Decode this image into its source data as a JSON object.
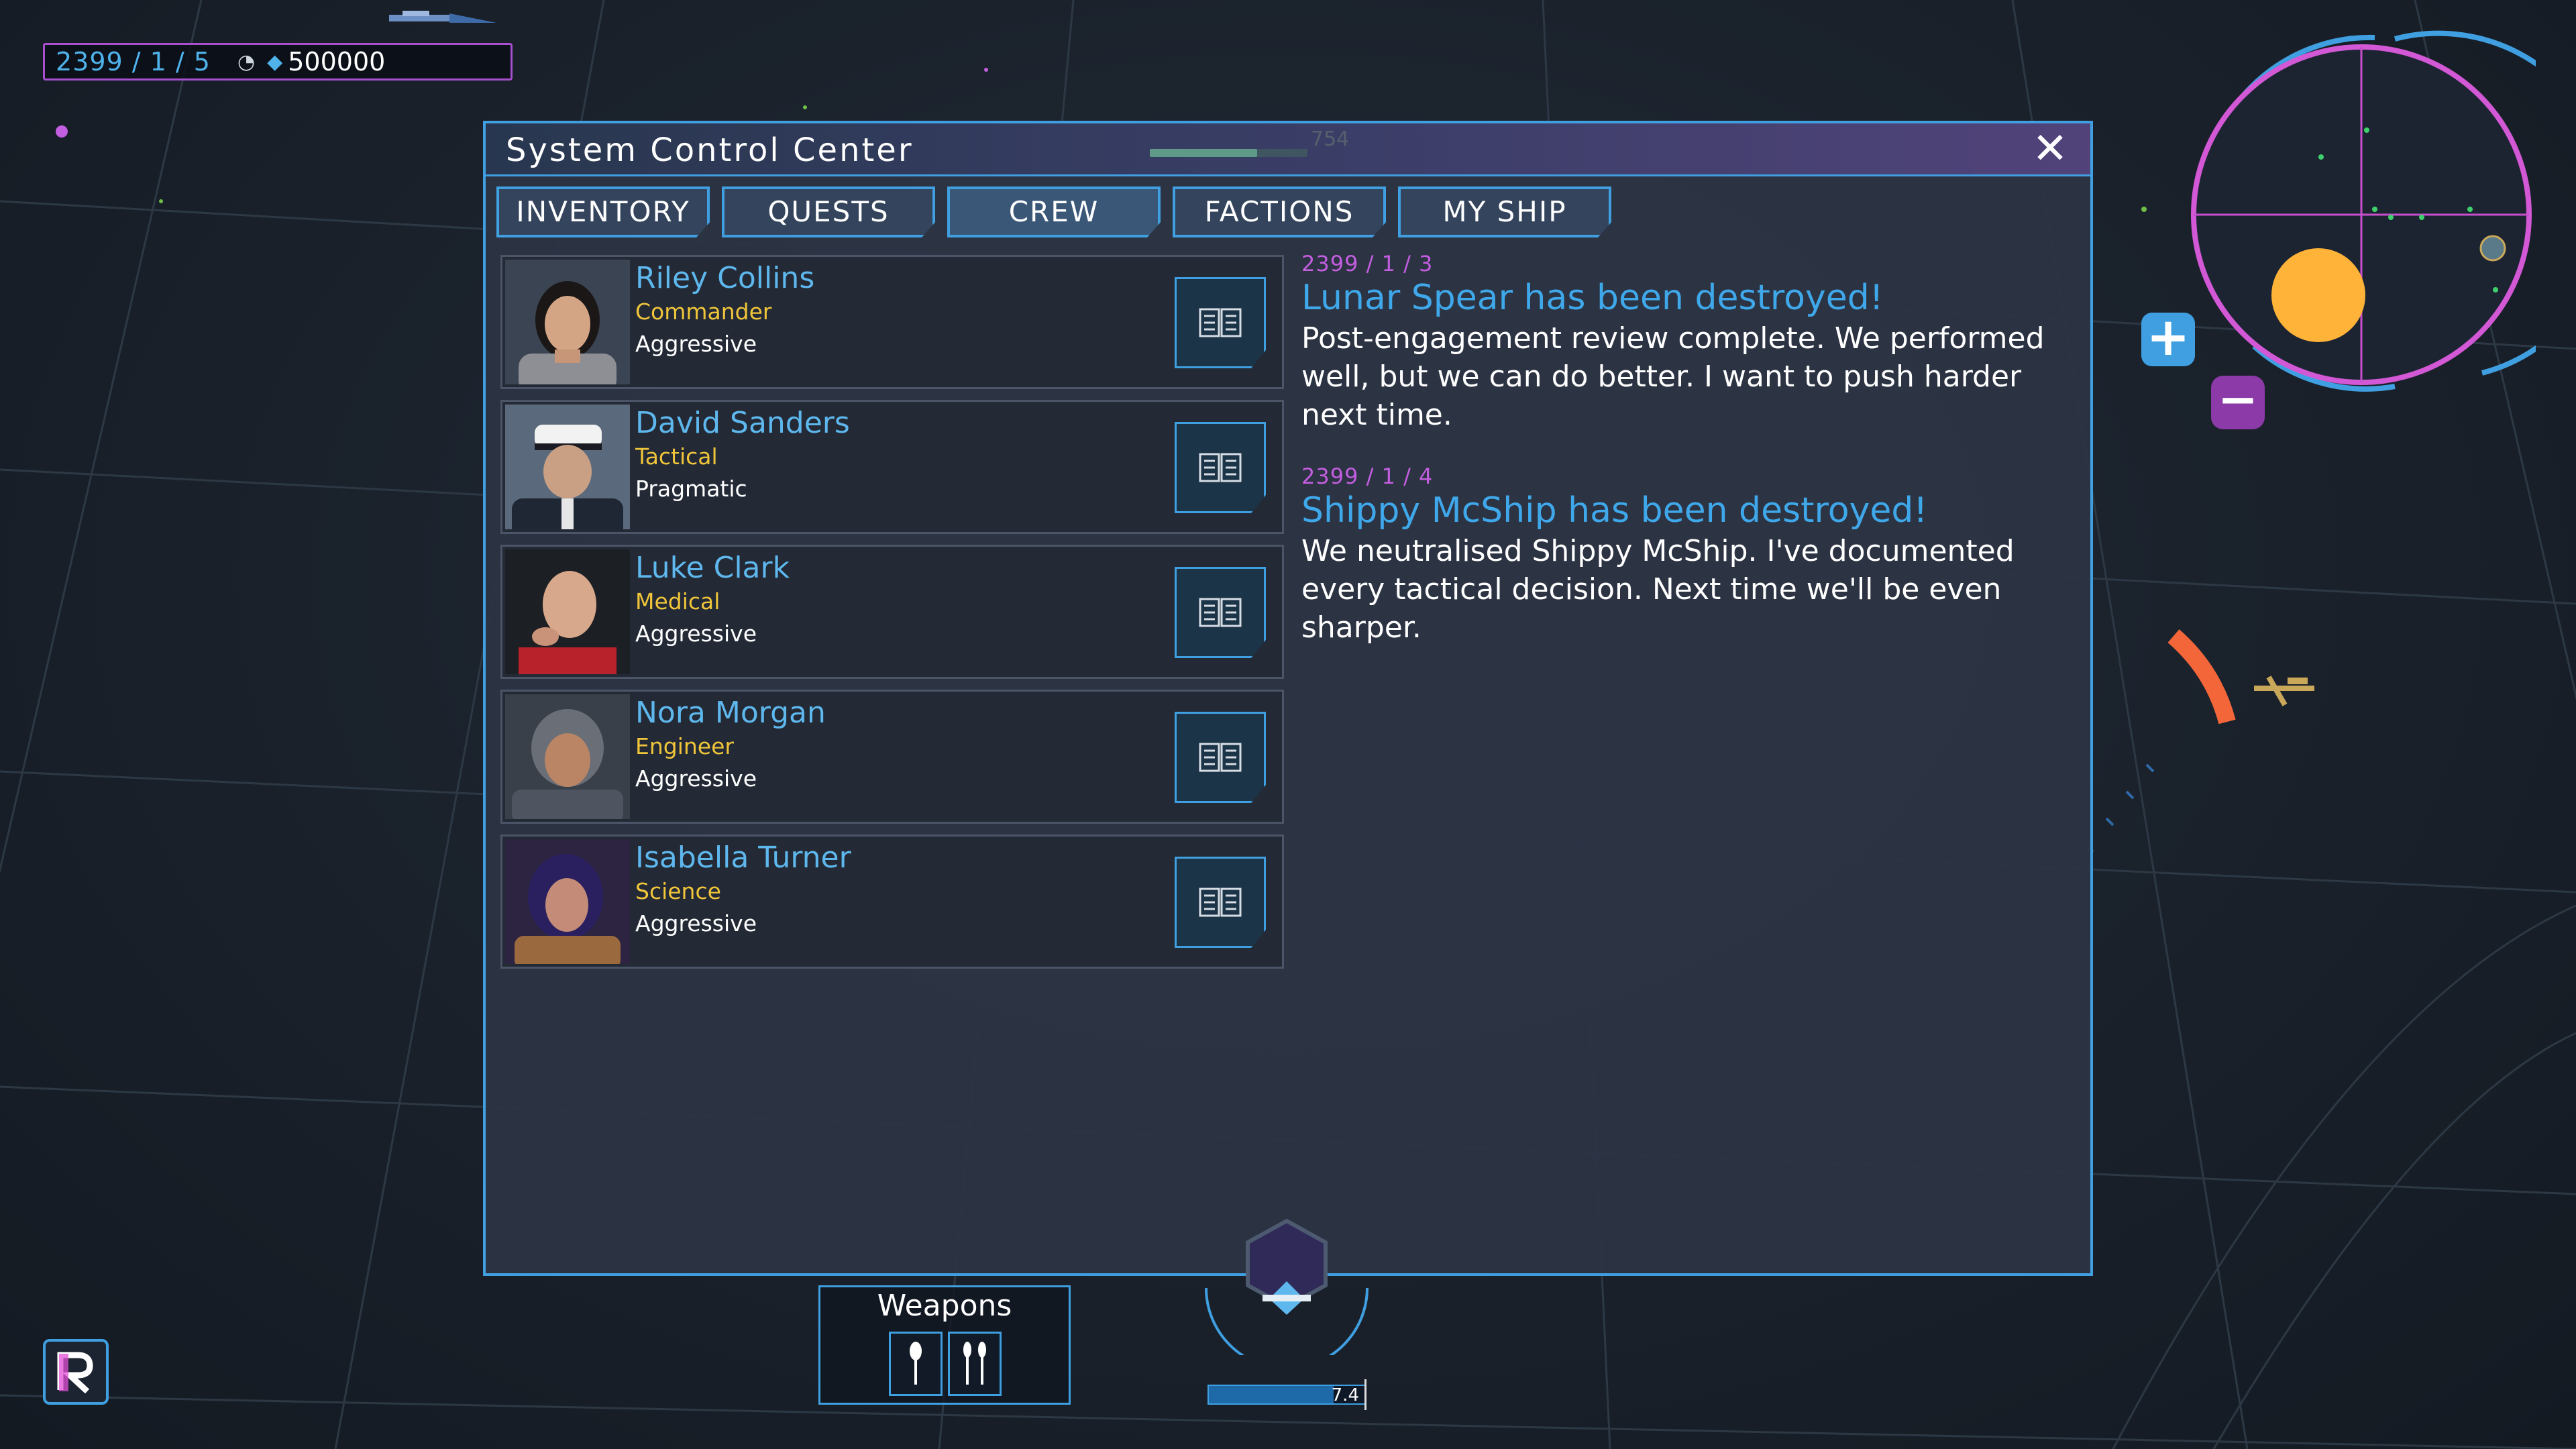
{
  "hud": {
    "date": "2399 / 1 / 5",
    "moon_icon": "moon-icon",
    "gem_icon": "gem-icon",
    "credits": "500000"
  },
  "panel": {
    "title": "System Control Center",
    "progress_value": "754",
    "progress_fraction": 0.68,
    "close_symbol": "✕"
  },
  "tabs": [
    {
      "label": "INVENTORY"
    },
    {
      "label": "QUESTS"
    },
    {
      "label": "CREW",
      "active": true
    },
    {
      "label": "FACTIONS"
    },
    {
      "label": "MY SHIP"
    }
  ],
  "crew": [
    {
      "name": "Riley Collins",
      "role": "Commander",
      "trait": "Aggressive"
    },
    {
      "name": "David Sanders",
      "role": "Tactical",
      "trait": "Pragmatic"
    },
    {
      "name": "Luke Clark",
      "role": "Medical",
      "trait": "Aggressive"
    },
    {
      "name": "Nora Morgan",
      "role": "Engineer",
      "trait": "Aggressive"
    },
    {
      "name": "Isabella Turner",
      "role": "Science",
      "trait": "Aggressive"
    }
  ],
  "log": [
    {
      "date": "2399 / 1 / 3",
      "title": "Lunar Spear has been destroyed!",
      "body": "Post-engagement review complete. We performed well, but we can do better. I want to push harder next time."
    },
    {
      "date": "2399 / 1 / 4",
      "title": "Shippy McShip has been destroyed!",
      "body": "We neutralised Shippy McShip. I've documented every tactical decision. Next time we'll be even sharper."
    }
  ],
  "radar": {
    "zoom_in": "+",
    "zoom_out": "−"
  },
  "weapons": {
    "label": "Weapons"
  },
  "speed": {
    "value": "7.4",
    "fraction": 0.8
  },
  "colors": {
    "accent": "#3f9fe0",
    "name": "#5eb8ee",
    "role": "#f0c53a",
    "log_date": "#c45ee0",
    "log_title": "#3fa8ea",
    "sun": "#ffb338",
    "radar_ring": "#d258d6"
  }
}
